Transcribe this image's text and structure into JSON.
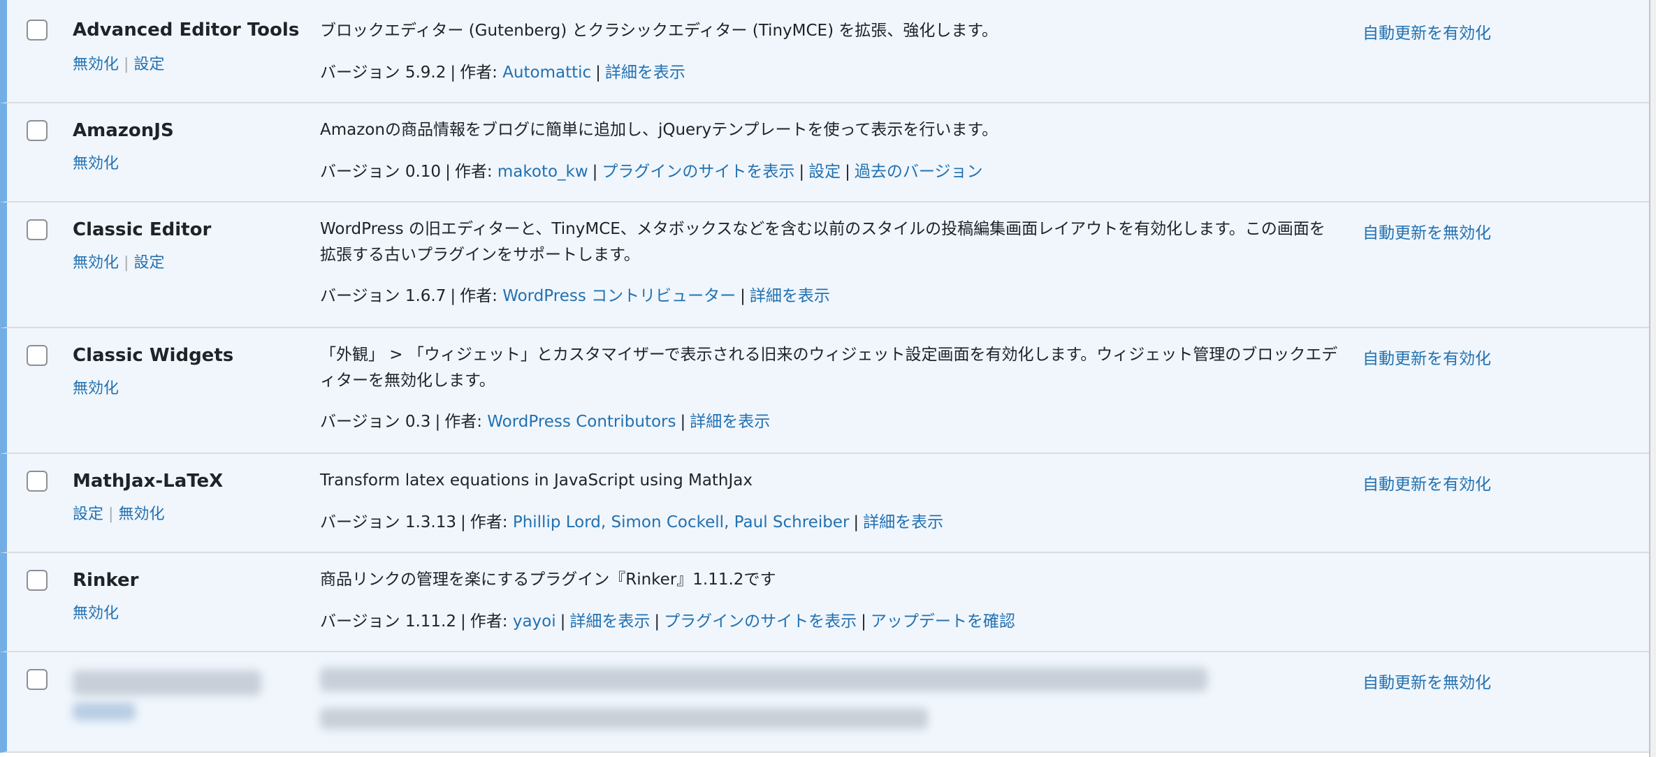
{
  "plugins": [
    {
      "name": "Advanced Editor Tools",
      "actions": [
        "無効化",
        "設定"
      ],
      "description": "ブロックエディター (Gutenberg) とクラシックエディター (TinyMCE) を拡張、強化します。",
      "version_label": "バージョン 5.9.2",
      "author_label": "作者:",
      "author": "Automattic",
      "links": [
        "詳細を表示"
      ],
      "auto_update": "自動更新を有効化"
    },
    {
      "name": "AmazonJS",
      "actions": [
        "無効化"
      ],
      "description": "Amazonの商品情報をブログに簡単に追加し、jQueryテンプレートを使って表示を行います。",
      "version_label": "バージョン 0.10",
      "author_label": "作者:",
      "author": "makoto_kw",
      "links": [
        "プラグインのサイトを表示",
        "設定",
        "過去のバージョン"
      ],
      "auto_update": ""
    },
    {
      "name": "Classic Editor",
      "actions": [
        "無効化",
        "設定"
      ],
      "description": "WordPress の旧エディターと、TinyMCE、メタボックスなどを含む以前のスタイルの投稿編集画面レイアウトを有効化します。この画面を拡張する古いプラグインをサポートします。",
      "version_label": "バージョン 1.6.7",
      "author_label": "作者:",
      "author": "WordPress コントリビューター",
      "links": [
        "詳細を表示"
      ],
      "auto_update": "自動更新を無効化"
    },
    {
      "name": "Classic Widgets",
      "actions": [
        "無効化"
      ],
      "description": "「外観」 > 「ウィジェット」とカスタマイザーで表示される旧来のウィジェット設定画面を有効化します。ウィジェット管理のブロックエディターを無効化します。",
      "version_label": "バージョン 0.3",
      "author_label": "作者:",
      "author": "WordPress Contributors",
      "links": [
        "詳細を表示"
      ],
      "auto_update": "自動更新を有効化"
    },
    {
      "name": "MathJax-LaTeX",
      "actions": [
        "設定",
        "無効化"
      ],
      "description": "Transform latex equations in JavaScript using MathJax",
      "version_label": "バージョン 1.3.13",
      "author_label": "作者:",
      "author": "Phillip Lord, Simon Cockell, Paul Schreiber",
      "links": [
        "詳細を表示"
      ],
      "auto_update": "自動更新を有効化"
    },
    {
      "name": "Rinker",
      "actions": [
        "無効化"
      ],
      "description": "商品リンクの管理を楽にするプラグイン『Rinker』1.11.2です",
      "version_label": "バージョン 1.11.2",
      "author_label": "作者:",
      "author": "yayoi",
      "links": [
        "詳細を表示",
        "プラグインのサイトを表示",
        "アップデートを確認"
      ],
      "auto_update": ""
    }
  ],
  "blurred_row": {
    "auto_update": "自動更新を無効化"
  },
  "colors": {
    "link": "#2271b1",
    "active_row_bg": "#f0f6fc",
    "active_border": "#72aee6"
  }
}
